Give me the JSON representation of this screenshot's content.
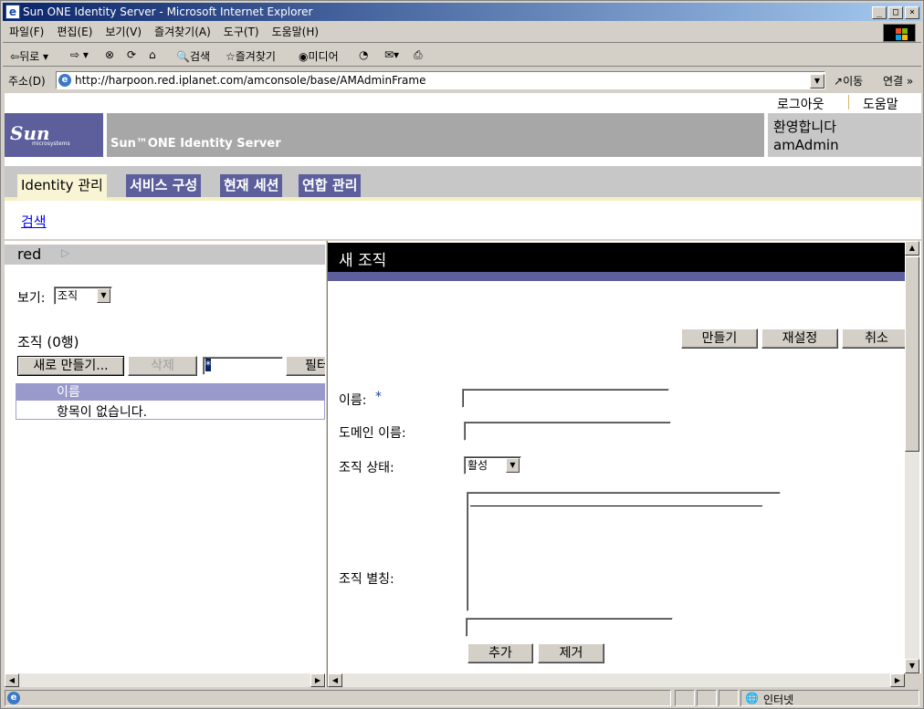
{
  "window": {
    "title": "Sun ONE Identity Server - Microsoft Internet Explorer"
  },
  "menu": [
    "파일(F)",
    "편집(E)",
    "보기(V)",
    "즐겨찾기(A)",
    "도구(T)",
    "도움말(H)"
  ],
  "toolbar": {
    "back": "뒤로",
    "search": "검색",
    "favorites": "즐겨찾기",
    "media": "미디어"
  },
  "address": {
    "label": "주소(D)",
    "url": "http://harpoon.red.iplanet.com/amconsole/base/AMAdminFrame",
    "go": "이동",
    "links": "연결"
  },
  "header": {
    "logout": "로그아웃",
    "help": "도움말",
    "product": "Sun™ONE Identity Server",
    "welcome": "환영합니다",
    "user": "amAdmin",
    "logo": "Sun",
    "logo_sub": "microsystems"
  },
  "tabs": [
    "Identity 관리",
    "서비스 구성",
    "현재 세션",
    "연합 관리"
  ],
  "subnav": {
    "search": "검색"
  },
  "left": {
    "location": "red",
    "view_label": "보기:",
    "view_value": "조직",
    "list_title": "조직 (0행)",
    "new_button": "새로 만들기...",
    "delete_button": "삭제",
    "filter_value": "*",
    "filter_button": "필터",
    "column_header": "이름",
    "empty_text": "항목이 없습니다."
  },
  "right": {
    "title": "새 조직",
    "create_button": "만들기",
    "reset_button": "재설정",
    "cancel_button": "취소",
    "name_label": "이름:",
    "required_mark": "*",
    "domain_label": "도메인 이름:",
    "status_label": "조직 상태:",
    "status_value": "활성",
    "alias_label": "조직 별칭:",
    "add_button": "추가",
    "remove_button": "제거"
  },
  "status": {
    "zone": "인터넷"
  }
}
